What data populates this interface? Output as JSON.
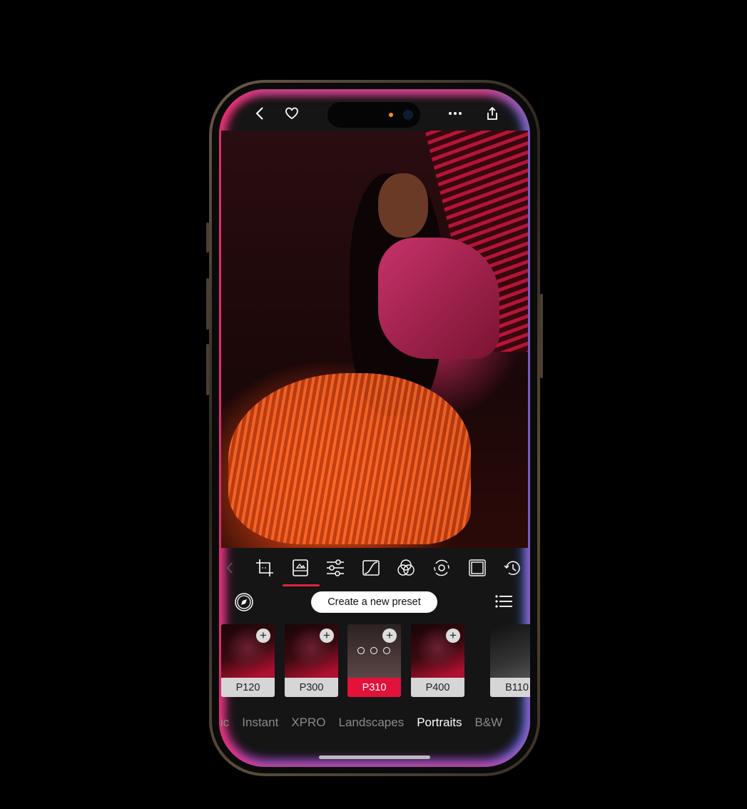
{
  "topbar": {
    "icons": [
      "chevron-left-icon",
      "heart-icon",
      "more-icon",
      "share-icon"
    ]
  },
  "toolbar": {
    "icons": [
      "chevron-left-icon",
      "crop-icon",
      "presets-icon",
      "sliders-icon",
      "curve-icon",
      "color-mix-icon",
      "rotate-icon",
      "frame-icon",
      "history-icon"
    ],
    "active": "presets-icon",
    "accent": "#e0243c"
  },
  "presets_bar": {
    "create_label": "Create a new preset"
  },
  "presets": [
    {
      "label": "P120",
      "selected": false
    },
    {
      "label": "P300",
      "selected": false
    },
    {
      "label": "P310",
      "selected": true
    },
    {
      "label": "P400",
      "selected": false
    },
    {
      "label": "B110",
      "selected": false
    }
  ],
  "categories": [
    {
      "label": "ic",
      "active": false
    },
    {
      "label": "Instant",
      "active": false
    },
    {
      "label": "XPRO",
      "active": false
    },
    {
      "label": "Landscapes",
      "active": false
    },
    {
      "label": "Portraits",
      "active": true
    },
    {
      "label": "B&W",
      "active": false
    }
  ],
  "colors": {
    "selected_preset": "#e2123a"
  }
}
